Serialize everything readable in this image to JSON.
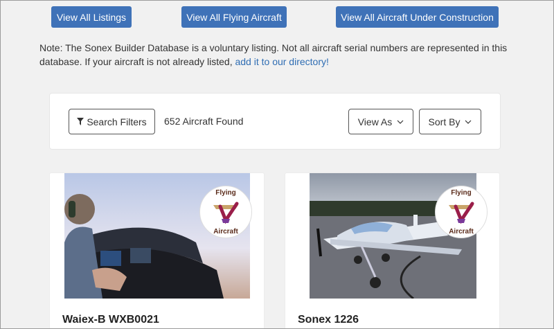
{
  "nav": {
    "all_listings": "View All Listings",
    "flying_aircraft": "View All Flying Aircraft",
    "under_construction": "View All Aircraft Under Construction"
  },
  "note": {
    "text": "Note: The Sonex Builder Database is a voluntary listing. Not all aircraft serial numbers are represented in this database. If your aircraft is not already listed, ",
    "link": "add it to our directory!"
  },
  "toolbar": {
    "filters_label": "Search Filters",
    "filter_icon": "filter-icon",
    "count": "652 Aircraft Found",
    "view_as_label": "View As",
    "sort_by_label": "Sort By",
    "chevron_icon": "chevron-down-icon"
  },
  "listings": [
    {
      "title": "Waiex-B WXB0021",
      "badge_top": "Flying",
      "badge_bottom": "Aircraft"
    },
    {
      "title": "Sonex 1226",
      "badge_top": "Flying",
      "badge_bottom": "Aircraft"
    }
  ],
  "colors": {
    "primary_button": "#3f72b8",
    "link": "#2f6db3",
    "page_bg": "#f1f1f1"
  }
}
